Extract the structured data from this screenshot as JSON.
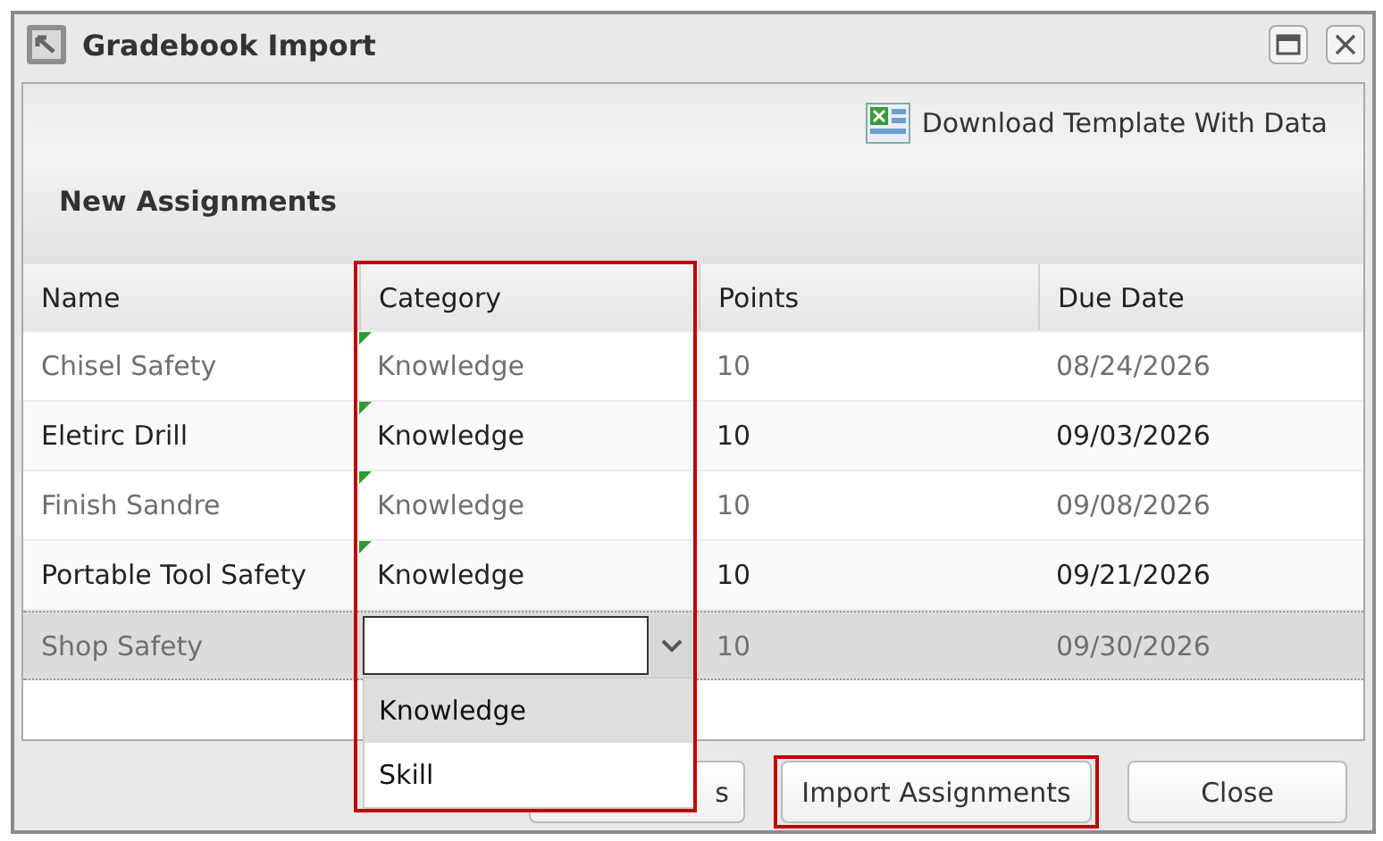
{
  "window": {
    "title": "Gradebook Import"
  },
  "download_link": "Download Template With Data",
  "section_title": "New Assignments",
  "table": {
    "columns": [
      {
        "label": "Name",
        "highlighted": false
      },
      {
        "label": "Category",
        "highlighted": true
      },
      {
        "label": "Points",
        "highlighted": false
      },
      {
        "label": "Due Date",
        "highlighted": false
      }
    ],
    "rows": [
      {
        "name": "Chisel Safety",
        "category": "Knowledge",
        "points": "10",
        "due_date": "08/24/2026",
        "dimmed": true,
        "modified": true,
        "selected": false,
        "editing": false
      },
      {
        "name": "Eletirc Drill",
        "category": "Knowledge",
        "points": "10",
        "due_date": "09/03/2026",
        "dimmed": false,
        "modified": true,
        "selected": false,
        "editing": false
      },
      {
        "name": "Finish Sandre",
        "category": "Knowledge",
        "points": "10",
        "due_date": "09/08/2026",
        "dimmed": true,
        "modified": true,
        "selected": false,
        "editing": false
      },
      {
        "name": "Portable Tool Safety",
        "category": "Knowledge",
        "points": "10",
        "due_date": "09/21/2026",
        "dimmed": false,
        "modified": true,
        "selected": false,
        "editing": false
      },
      {
        "name": "Shop Safety",
        "points": "10",
        "due_date": "09/30/2026",
        "dimmed": true,
        "modified": false,
        "selected": true,
        "editing": true
      }
    ]
  },
  "dropdown": {
    "options": [
      {
        "label": "Knowledge",
        "selected": true
      },
      {
        "label": "Skill",
        "selected": false
      }
    ]
  },
  "buttons": [
    {
      "label": "s",
      "highlighted": false
    },
    {
      "label": "Import Assignments",
      "highlighted": true
    },
    {
      "label": "Close",
      "highlighted": false
    }
  ]
}
